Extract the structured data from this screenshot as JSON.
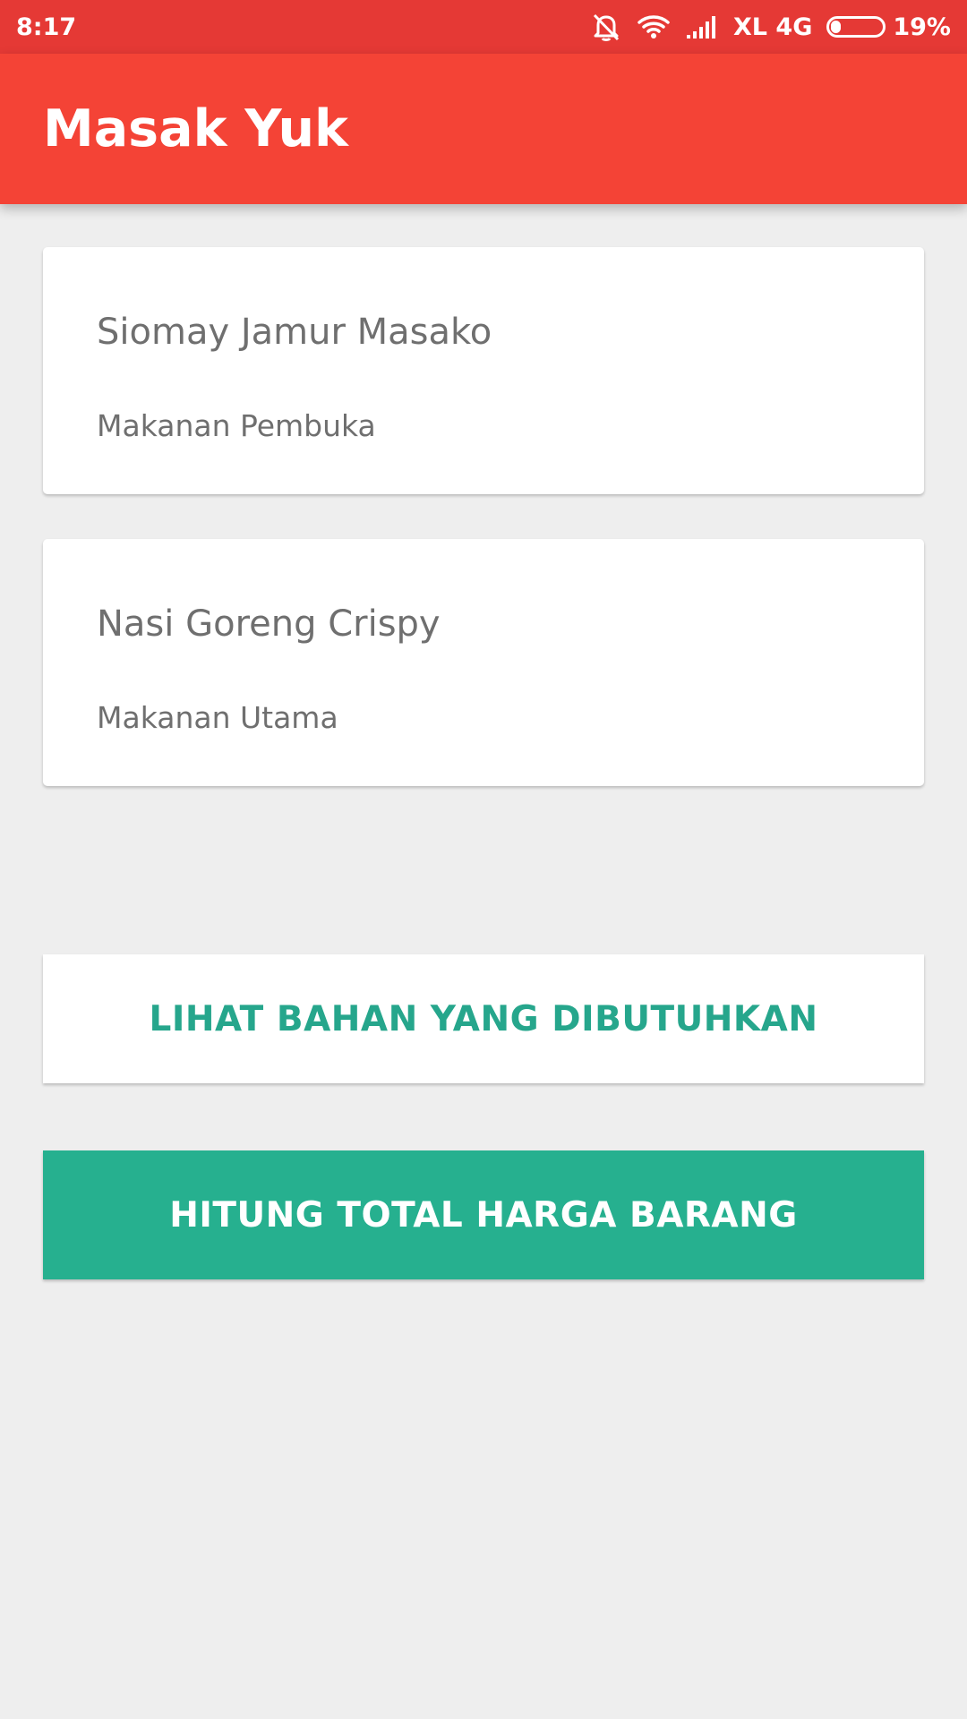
{
  "status_bar": {
    "time": "8:17",
    "network": "XL 4G",
    "battery_percent_label": "19%",
    "battery_level": 0.19,
    "icons": [
      "mute-notification-icon",
      "wifi-icon",
      "signal-icon",
      "battery-icon"
    ]
  },
  "app_bar": {
    "title": "Masak Yuk",
    "color": "#f44336"
  },
  "recipes": [
    {
      "name": "Siomay Jamur Masako",
      "category": "Makanan Pembuka"
    },
    {
      "name": "Nasi Goreng Crispy",
      "category": "Makanan Utama"
    }
  ],
  "buttons": {
    "view_ingredients": "LIHAT BAHAN YANG DIBUTUHKAN",
    "calculate_total": "HITUNG TOTAL HARGA BARANG"
  },
  "colors": {
    "accent": "#26b08f",
    "status_bar": "#e53935",
    "background": "#eeeeee"
  }
}
